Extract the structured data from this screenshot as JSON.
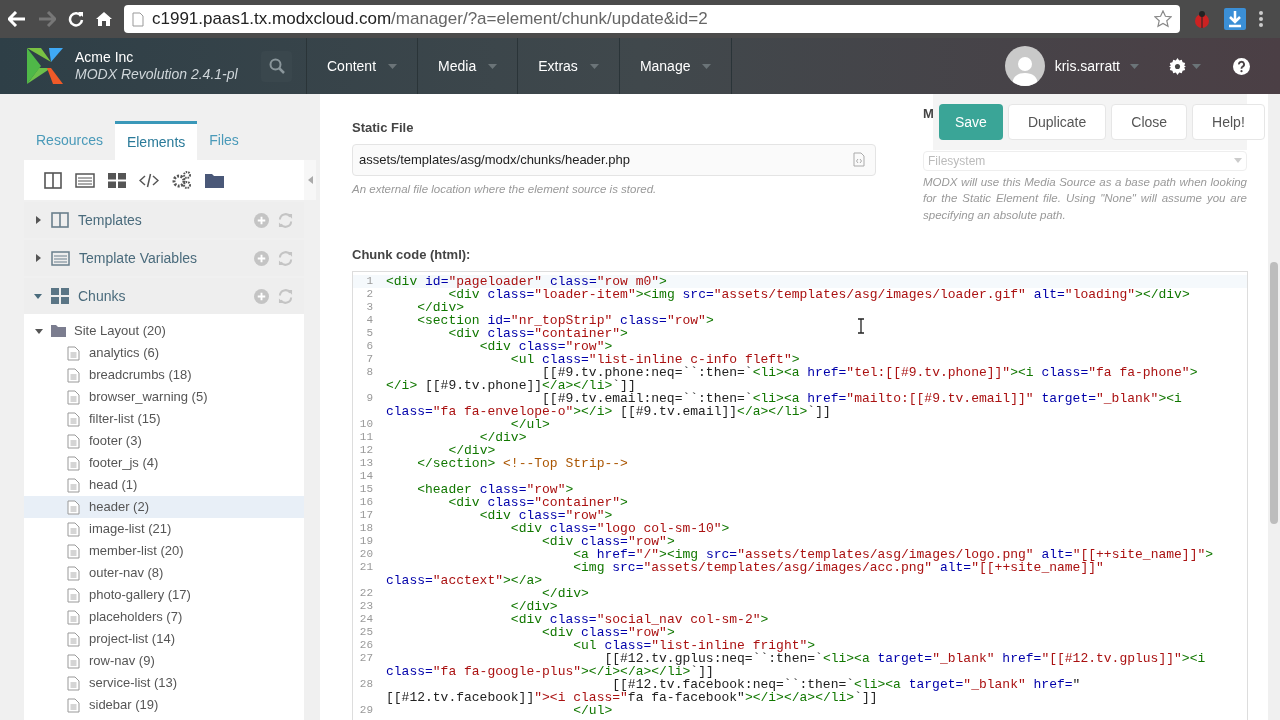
{
  "browser": {
    "url_host": "c1991.paas1.tx.modxcloud.com",
    "url_path": "/manager/?a=element/chunk/update&id=2"
  },
  "header": {
    "site_name": "Acme Inc",
    "version": "MODX Revolution 2.4.1-pl",
    "user": "kris.sarratt",
    "menu": [
      {
        "label": "Content"
      },
      {
        "label": "Media"
      },
      {
        "label": "Extras"
      },
      {
        "label": "Manage"
      }
    ]
  },
  "sidebar": {
    "tabs": [
      {
        "label": "Resources",
        "selected": false
      },
      {
        "label": "Elements",
        "selected": true
      },
      {
        "label": "Files",
        "selected": false
      }
    ],
    "sections": [
      {
        "label": "Templates",
        "kind": "templates",
        "expanded": false
      },
      {
        "label": "Template Variables",
        "kind": "variables",
        "expanded": false
      },
      {
        "label": "Chunks",
        "kind": "chunks",
        "expanded": true
      }
    ],
    "tree": {
      "label": "Site Layout (20)",
      "expanded": true,
      "children": [
        {
          "label": "analytics (6)",
          "selected": false
        },
        {
          "label": "breadcrumbs (18)",
          "selected": false
        },
        {
          "label": "browser_warning (5)",
          "selected": false
        },
        {
          "label": "filter-list (15)",
          "selected": false
        },
        {
          "label": "footer (3)",
          "selected": false
        },
        {
          "label": "footer_js (4)",
          "selected": false
        },
        {
          "label": "head (1)",
          "selected": false
        },
        {
          "label": "header (2)",
          "selected": true
        },
        {
          "label": "image-list (21)",
          "selected": false
        },
        {
          "label": "member-list (20)",
          "selected": false
        },
        {
          "label": "outer-nav (8)",
          "selected": false
        },
        {
          "label": "photo-gallery (17)",
          "selected": false
        },
        {
          "label": "placeholders (7)",
          "selected": false
        },
        {
          "label": "project-list (14)",
          "selected": false
        },
        {
          "label": "row-nav (9)",
          "selected": false
        },
        {
          "label": "service-list (13)",
          "selected": false
        },
        {
          "label": "sidebar (19)",
          "selected": false
        }
      ]
    }
  },
  "form": {
    "static_file": {
      "label": "Static File",
      "value": "assets/templates/asg/modx/chunks/header.php",
      "help": "An external file location where the element source is stored."
    },
    "media_source": {
      "label": "M",
      "value": "Filesystem",
      "help": "MODX will use this Media Source as a base path when looking for the Static Element file. Using \"None\" will assume you are specifying an absolute path."
    },
    "code": {
      "label": "Chunk code (html):",
      "lines": [
        {
          "number": "1",
          "text": "<div id=\"pageloader\" class=\"row m0\">"
        },
        {
          "number": "2",
          "text": "        <div class=\"loader-item\"><img src=\"assets/templates/asg/images/loader.gif\" alt=\"loading\"></div>"
        },
        {
          "number": "3",
          "text": "    </div>"
        },
        {
          "number": "4",
          "text": "    <section id=\"nr_topStrip\" class=\"row\">"
        },
        {
          "number": "5",
          "text": "        <div class=\"container\">"
        },
        {
          "number": "6",
          "text": "            <div class=\"row\">"
        },
        {
          "number": "7",
          "text": "                <ul class=\"list-inline c-info fleft\">"
        },
        {
          "number": "8",
          "text": "                    [[#9.tv.phone:neq=``:then=`<li><a href=\"tel:[[#9.tv.phone]]\"><i class=\"fa fa-phone\">",
          "wrap": "</i> [[#9.tv.phone]]</a></li>`]]"
        },
        {
          "number": "9",
          "text": "                    [[#9.tv.email:neq=``:then=`<li><a href=\"mailto:[[#9.tv.email]]\" target=\"_blank\"><i",
          "wrap": "class=\"fa fa-envelope-o\"></i> [[#9.tv.email]]</a></li>`]]"
        },
        {
          "number": "10",
          "text": "                </ul>"
        },
        {
          "number": "11",
          "text": "            </div>"
        },
        {
          "number": "12",
          "text": "        </div>"
        },
        {
          "number": "13",
          "text": "    </section> <!--Top Strip-->"
        },
        {
          "number": "14"
        },
        {
          "number": "15",
          "text": "    <header class=\"row\">"
        },
        {
          "number": "16",
          "text": "        <div class=\"container\">"
        },
        {
          "number": "17",
          "text": "            <div class=\"row\">"
        },
        {
          "number": "18",
          "text": "                <div class=\"logo col-sm-10\">"
        },
        {
          "number": "19",
          "text": "                    <div class=\"row\">"
        },
        {
          "number": "20",
          "text": "                        <a href=\"/\"><img src=\"assets/templates/asg/images/logo.png\" alt=\"[[++site_name]]\">"
        },
        {
          "number": "21",
          "text": "                        <img src=\"assets/templates/asg/images/acc.png\" alt=\"[[++site_name]]\"",
          "wrap": "class=\"acctext\"></a>"
        },
        {
          "number": "22",
          "text": "                    </div>"
        },
        {
          "number": "23",
          "text": "                </div>"
        },
        {
          "number": "24",
          "text": "                <div class=\"social_nav col-sm-2\">"
        },
        {
          "number": "25",
          "text": "                    <div class=\"row\">"
        },
        {
          "number": "26",
          "text": "                        <ul class=\"list-inline fright\">"
        },
        {
          "number": "27",
          "text": "                            [[#12.tv.gplus:neq=``:then=`<li><a target=\"_blank\" href=\"[[#12.tv.gplus]]\"><i",
          "wrap": "class=\"fa fa-google-plus\"></i></a></li>`]]"
        },
        {
          "number": "28",
          "text": "                             [[#12.tv.facebook:neq=``:then=`<li><a target=\"_blank\" href=\"",
          "wrap": "[[#12.tv.facebook]]\"><i class=\"fa fa-facebook\"></i></a></li>`]]"
        },
        {
          "number": "29",
          "text": "                        </ul>"
        }
      ]
    }
  },
  "actions": [
    {
      "label": "Save",
      "kind": "primary"
    },
    {
      "label": "Duplicate",
      "kind": "default"
    },
    {
      "label": "Close",
      "kind": "default"
    },
    {
      "label": "Help!",
      "kind": "default"
    }
  ]
}
